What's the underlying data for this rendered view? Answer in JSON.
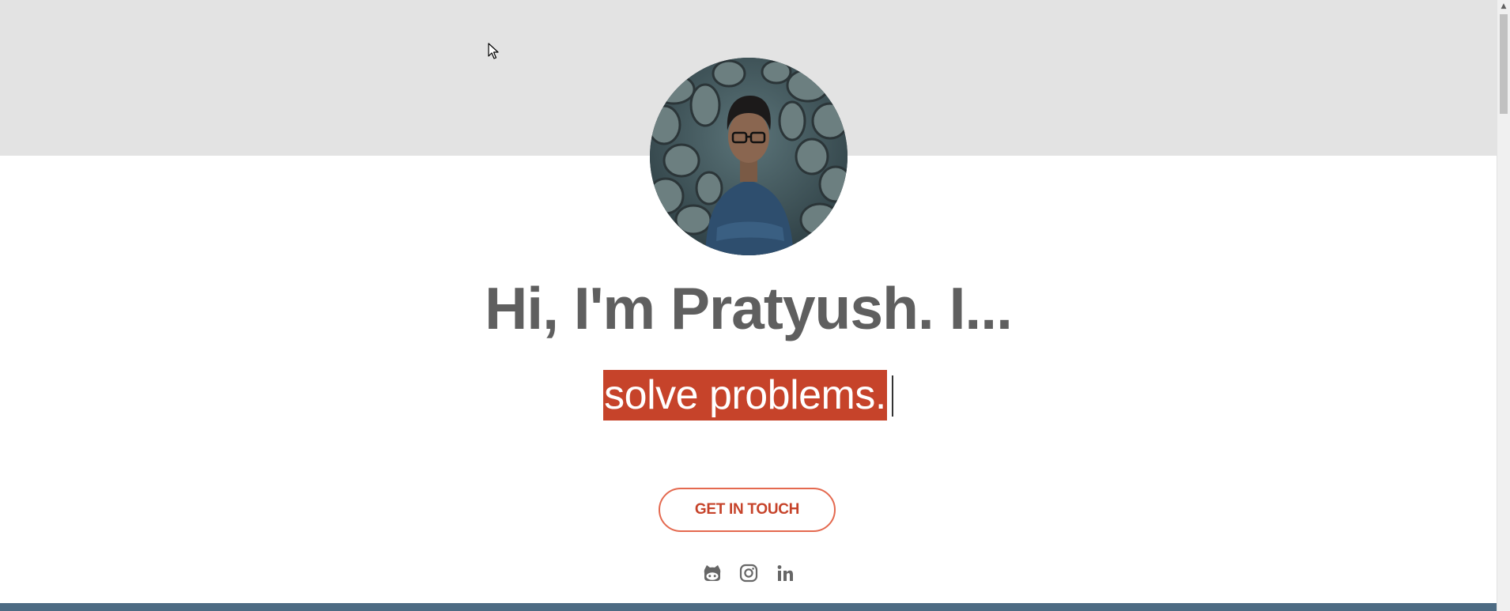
{
  "hero": {
    "headline": "Hi, I'm Pratyush. I...",
    "typed_text": "solve problems.",
    "cta_label": "GET IN TOUCH"
  },
  "socials": [
    {
      "icon": "github-icon"
    },
    {
      "icon": "instagram-icon"
    },
    {
      "icon": "linkedin-icon"
    }
  ],
  "colors": {
    "header_band": "#e3e3e3",
    "accent": "#c6432a",
    "cta_border": "#e4694f",
    "headline": "#5f5f5f",
    "footer_band": "#4d6b83",
    "icon": "#666666"
  },
  "scrollbar": {
    "up_arrow_glyph": "▲"
  }
}
